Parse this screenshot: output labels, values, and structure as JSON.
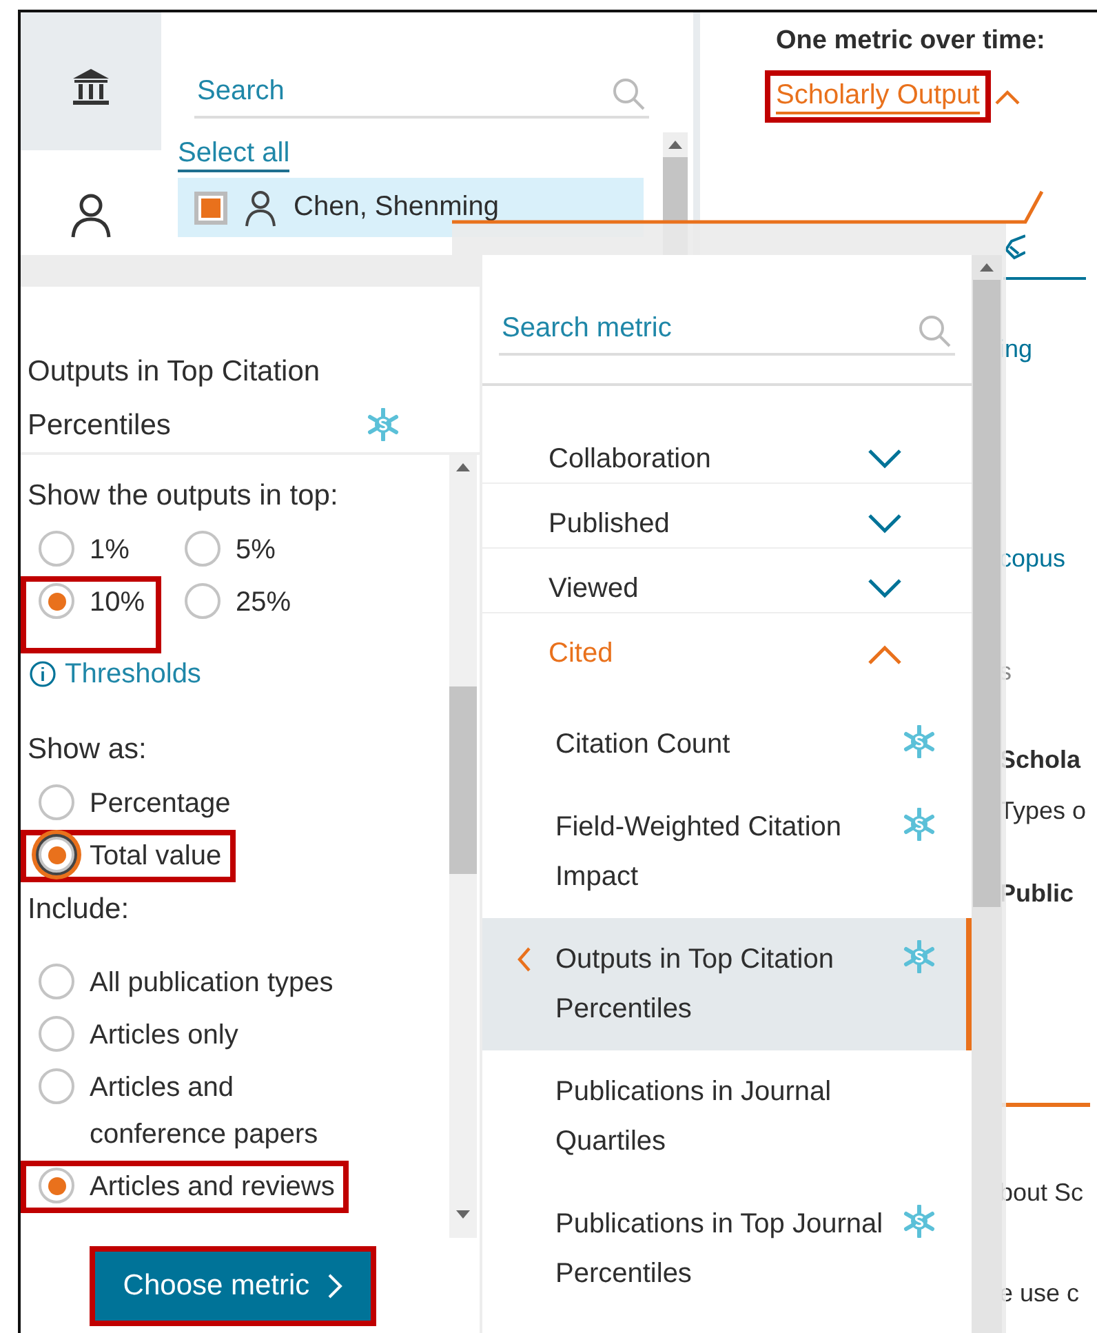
{
  "sidebar_icons": [
    {
      "selected": false
    },
    {
      "selected": true
    }
  ],
  "entity_list": {
    "search": {
      "placeholder": "Search"
    },
    "select_all": "Select all",
    "items": [
      {
        "name": "Chen, Shenming",
        "checked": true
      }
    ]
  },
  "header": {
    "title": "One metric over time:",
    "metric_link": "Scholarly Output",
    "highlighted": true
  },
  "background_fragments": [
    {
      "text": "ing",
      "kind": "link"
    },
    {
      "text": "copus",
      "kind": "link"
    },
    {
      "text": "s",
      "kind": "muted"
    },
    {
      "text": "Schola",
      "kind": "bold"
    },
    {
      "text": "Types o",
      "kind": "plain"
    },
    {
      "text": "Public",
      "kind": "bold"
    },
    {
      "text": "bout Sc",
      "kind": "plain"
    },
    {
      "text": "e use c",
      "kind": "plain"
    }
  ],
  "metric_options": {
    "title": "Outputs in Top Citation Percentiles",
    "sections": [
      {
        "kind": "radio_grid",
        "heading": "Show the outputs in top:",
        "options": [
          {
            "label": "1%",
            "selected": false,
            "focused": false,
            "highlighted": false
          },
          {
            "label": "5%",
            "selected": false,
            "focused": false,
            "highlighted": false
          },
          {
            "label": "10%",
            "selected": true,
            "focused": false,
            "highlighted": true
          },
          {
            "label": "25%",
            "selected": false,
            "focused": false,
            "highlighted": false
          }
        ]
      },
      {
        "kind": "info_link",
        "text": "Thresholds"
      },
      {
        "kind": "radio_list",
        "heading": "Show as:",
        "options": [
          {
            "label": "Percentage",
            "selected": false,
            "focused": false,
            "highlighted": false
          },
          {
            "label": "Total value",
            "selected": true,
            "focused": true,
            "highlighted": true
          }
        ]
      },
      {
        "kind": "radio_list",
        "heading": "Include:",
        "options": [
          {
            "label": "All publication types",
            "selected": false,
            "focused": false,
            "highlighted": false
          },
          {
            "label": "Articles only",
            "selected": false,
            "focused": false,
            "highlighted": false
          },
          {
            "label": "Articles and conference papers",
            "selected": false,
            "focused": false,
            "highlighted": false
          },
          {
            "label": "Articles and reviews",
            "selected": true,
            "focused": false,
            "highlighted": true
          }
        ]
      }
    ],
    "button": {
      "label": "Choose metric",
      "highlighted": true
    }
  },
  "metric_picker": {
    "search": {
      "placeholder": "Search metric"
    },
    "categories": [
      {
        "label": "Collaboration",
        "expanded": false
      },
      {
        "label": "Published",
        "expanded": false
      },
      {
        "label": "Viewed",
        "expanded": false
      },
      {
        "label": "Cited",
        "expanded": true,
        "items": [
          {
            "label": "Citation Count",
            "badge": true,
            "selected": false
          },
          {
            "label": "Field-Weighted Citation Impact",
            "badge": true,
            "selected": false
          },
          {
            "label": "Outputs in Top Citation Percentiles",
            "badge": true,
            "selected": true
          },
          {
            "label": "Publications in Journal Quartiles",
            "badge": false,
            "selected": false
          },
          {
            "label": "Publications in Top Journal Percentiles",
            "badge": true,
            "selected": false
          }
        ]
      }
    ]
  }
}
